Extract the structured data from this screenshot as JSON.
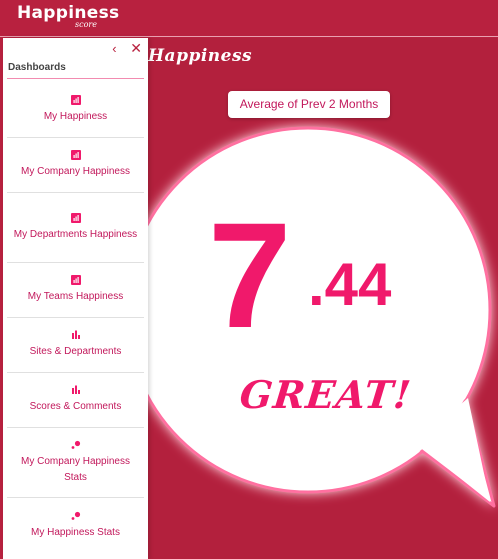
{
  "app": {
    "logo_text": "Happiness",
    "logo_sub": "score"
  },
  "main": {
    "title": "Happiness",
    "period_button": "Average of Prev 2 Months",
    "score_int": "7",
    "score_dec": ".44",
    "score_label": "GREAT!"
  },
  "sidebar": {
    "collapse_icon": "‹",
    "close_icon": "✕",
    "heading": "Dashboards",
    "items": [
      {
        "label": "My Happiness",
        "icon": "bar-chart-box-icon"
      },
      {
        "label": "My Company Happiness",
        "icon": "bar-chart-box-icon"
      },
      {
        "label": "My Departments Happiness",
        "icon": "bar-chart-box-icon"
      },
      {
        "label": "My Teams Happiness",
        "icon": "bar-chart-box-icon"
      },
      {
        "label": "Sites & Departments",
        "icon": "bar-chart-icon"
      },
      {
        "label": "Scores & Comments",
        "icon": "bar-chart-icon"
      },
      {
        "label": "My Company Happiness Stats",
        "icon": "scatter-dots-icon"
      },
      {
        "label": "My Happiness Stats",
        "icon": "scatter-dots-icon"
      }
    ]
  },
  "colors": {
    "brand": "#b8213f",
    "accent": "#f0196b",
    "link": "#c2185b"
  }
}
